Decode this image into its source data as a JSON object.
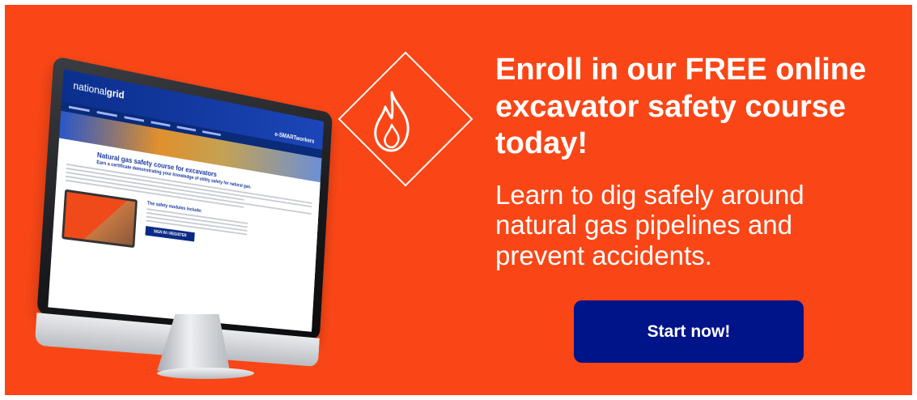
{
  "banner": {
    "background_color": "#fa4616",
    "headline": "Enroll in our FREE online excavator safety course today!",
    "subcopy": "Learn to dig safely around natural gas pipelines and prevent accidents.",
    "cta_label": "Start now!",
    "cta_color": "#001489",
    "icon": "flame-diamond-icon"
  },
  "monitor_site": {
    "logo_regular": "national",
    "logo_bold": "grid",
    "brand": "e-SMARTworkers",
    "title": "Natural gas safety course for excavators",
    "subtitle": "Earn a certificate demonstrating your knowledge of utility safety for natural gas.",
    "modules_heading": "The safety modules include:",
    "signin_label": "SIGN IN / REGISTER"
  }
}
